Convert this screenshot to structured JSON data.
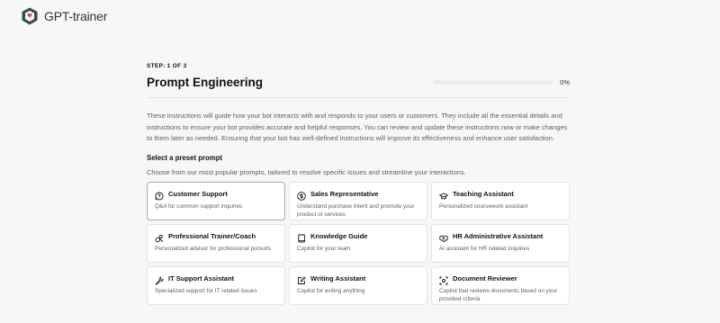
{
  "app": {
    "brand": "GPT-trainer"
  },
  "step": {
    "label": "STEP: 1 OF 3",
    "title": "Prompt Engineering",
    "progress_value": 0,
    "progress_label": "0%"
  },
  "intro": "These instructions will guide how your bot interacts with and responds to your users or customers. They include all the essential details and instructions to ensure your bot provides accurate and helpful responses. You can review and update these instructions now or make changes to them later as needed. Ensuring that your bot has well-defined instructions will improve its effectiveness and enhance user satisfaction.",
  "preset": {
    "title": "Select a preset prompt",
    "subtitle": "Choose from our most popular prompts, tailored to resolve specific issues and streamline your interactions.",
    "cards": [
      {
        "title": "Customer Support",
        "desc": "Q&A for common support inquiries",
        "icon": "chat-question-icon",
        "selected": true
      },
      {
        "title": "Sales Representative",
        "desc": "Understand purchase intent and promote your product or services",
        "icon": "dollar-icon",
        "selected": false
      },
      {
        "title": "Teaching Assistant",
        "desc": "Personalized coursework assistant",
        "icon": "graduation-cap-icon",
        "selected": false
      },
      {
        "title": "Professional Trainer/Coach",
        "desc": "Personalized advisor for professional pursuits",
        "icon": "coach-icon",
        "selected": false
      },
      {
        "title": "Knowledge Guide",
        "desc": "Copilot for your team",
        "icon": "book-icon",
        "selected": false
      },
      {
        "title": "HR Administrative Assistant",
        "desc": "AI assistant for HR related inquiries",
        "icon": "handshake-icon",
        "selected": false
      },
      {
        "title": "IT Support Assistant",
        "desc": "Specialized support for IT related issues",
        "icon": "wrench-icon",
        "selected": false
      },
      {
        "title": "Writing Assistant",
        "desc": "Copilot for writing anything",
        "icon": "pencil-square-icon",
        "selected": false
      },
      {
        "title": "Document Reviewer",
        "desc": "Copilot that reviews documents based on your provided criteria",
        "icon": "scan-icon",
        "selected": false
      }
    ]
  },
  "colors": {
    "brand_mark": "#3a4556",
    "brand_accent": "#e04d4d",
    "selected_border": "#a7a7ad"
  }
}
